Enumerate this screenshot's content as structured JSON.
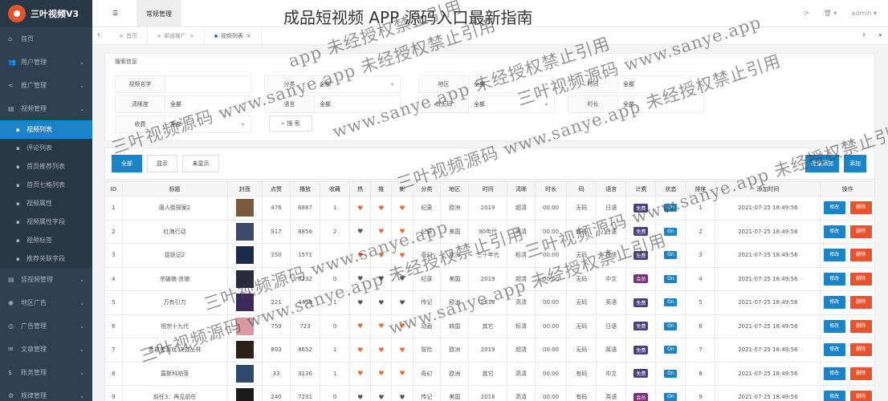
{
  "brand": {
    "title": "三叶视频V3"
  },
  "page_heading": "成品短视频 APP 源码入口最新指南",
  "topbar": {
    "tab_label": "常规管理",
    "user": "admin ▾",
    "refresh_icon": "⟳",
    "trash_icon": "🗑 ▾"
  },
  "tabs": [
    {
      "label": "首页",
      "active": false,
      "closable": false
    },
    {
      "label": "渠道推广",
      "active": false,
      "closable": true
    },
    {
      "label": "视频列表",
      "active": true,
      "closable": true
    }
  ],
  "sidebar": {
    "items_top": [
      {
        "label": "首页",
        "icon": "home-icon",
        "glyph": "⌂",
        "chevron": false
      },
      {
        "label": "用户管理",
        "icon": "users-icon",
        "glyph": "👥",
        "chevron": true
      },
      {
        "label": "推广管理",
        "icon": "share-icon",
        "glyph": "<",
        "chevron": true
      },
      {
        "label": "视频管理",
        "icon": "film-icon",
        "glyph": "▤",
        "chevron": true
      }
    ],
    "sub_items": [
      {
        "label": "视频列表",
        "active": true
      },
      {
        "label": "评论列表",
        "active": false
      },
      {
        "label": "首页推荐列表",
        "active": false
      },
      {
        "label": "首页七格列表",
        "active": false
      },
      {
        "label": "视频属性",
        "active": false
      },
      {
        "label": "视频属性字段",
        "active": false
      },
      {
        "label": "视频标签",
        "active": false
      },
      {
        "label": "推荐关联字段",
        "active": false
      }
    ],
    "items_bottom": [
      {
        "label": "竖视频管理",
        "icon": "film-icon",
        "glyph": "▤",
        "chevron": true
      },
      {
        "label": "地区广告",
        "icon": "globe-icon",
        "glyph": "◉",
        "chevron": true
      },
      {
        "label": "广告管理",
        "icon": "ad-icon",
        "glyph": "◎",
        "chevron": true
      },
      {
        "label": "文章管理",
        "icon": "mail-icon",
        "glyph": "✉",
        "chevron": true
      },
      {
        "label": "账务管理",
        "icon": "dollar-icon",
        "glyph": "$",
        "chevron": true
      },
      {
        "label": "规律管理",
        "icon": "settings-icon",
        "glyph": "⚙",
        "chevron": true
      }
    ]
  },
  "search": {
    "legend": "搜索信息",
    "fields": [
      {
        "label": "视频名字",
        "value": "",
        "dropdown": false
      },
      {
        "label": "分类",
        "value": "全部",
        "dropdown": true
      },
      {
        "label": "地区",
        "value": "全部",
        "dropdown": true
      },
      {
        "label": "时间",
        "value": "全部",
        "dropdown": false
      },
      {
        "label": "清晰度",
        "value": "全部",
        "dropdown": true
      },
      {
        "label": "语言",
        "value": "全部",
        "dropdown": false
      },
      {
        "label": "有无码",
        "value": "全部",
        "dropdown": true
      },
      {
        "label": "时长",
        "value": "全部",
        "dropdown": false
      },
      {
        "label": "收费",
        "value": "全部",
        "dropdown": true
      }
    ],
    "button": "搜 索"
  },
  "toolbar": {
    "filter_all": "全部",
    "filter_show": "显示",
    "filter_hide": "未显示",
    "batch_add": "批量添加",
    "add": "添加"
  },
  "table": {
    "headers": [
      "ID",
      "标题",
      "封面",
      "点赞",
      "播放",
      "收藏",
      "热",
      "推",
      "新",
      "分类",
      "地区",
      "时间",
      "清晰",
      "时长",
      "码",
      "语言",
      "计费",
      "状态",
      "排序",
      "添加时间",
      "操作"
    ],
    "edit_label": "修改",
    "delete_label": "删除",
    "rows": [
      {
        "id": "1",
        "title": "唐人街探案2",
        "cover": "#7a5a3c",
        "likes": "476",
        "plays": "6887",
        "fav": "1",
        "hot": true,
        "rec": true,
        "new": true,
        "cat": "纪录",
        "area": "欧洲",
        "time": "2019",
        "clarity": "超清",
        "dur": "00:00",
        "code": "无码",
        "lang": "日语",
        "fee": "免费",
        "fee_vip": false,
        "status": "On",
        "sort": "1",
        "added": "2021-07-25 18:49:56"
      },
      {
        "id": "2",
        "title": "红海行动",
        "cover": "#3c4a6b",
        "likes": "917",
        "plays": "8856",
        "fav": "2",
        "hot": false,
        "rec": true,
        "new": true,
        "cat": "纪录",
        "area": "美国",
        "time": "90年代",
        "clarity": "高清",
        "dur": "00:00",
        "code": "有码",
        "lang": "日语",
        "fee": "免费",
        "fee_vip": false,
        "status": "On",
        "sort": "2",
        "added": "2021-07-25 18:49:56"
      },
      {
        "id": "3",
        "title": "捉妖记2",
        "cover": "#1e2a4a",
        "likes": "250",
        "plays": "1571",
        "fav": "",
        "hot": true,
        "rec": true,
        "new": true,
        "cat": "奇幻",
        "area": "欧洲",
        "time": "三十年代",
        "clarity": "标清",
        "dur": "00:00",
        "code": "无码",
        "lang": "日语",
        "fee": "免费",
        "fee_vip": false,
        "status": "On",
        "sort": "3",
        "added": "2021-07-25 18:49:56"
      },
      {
        "id": "4",
        "title": "杀破狼·贪狼",
        "cover": "#2a2a3a",
        "likes": "",
        "plays": "8232",
        "fav": "0",
        "hot": false,
        "rec": false,
        "new": false,
        "cat": "纪录",
        "area": "美国",
        "time": "2019",
        "clarity": "超清",
        "dur": "00:00",
        "code": "无码",
        "lang": "中文",
        "fee": "会员",
        "fee_vip": true,
        "status": "On",
        "sort": "4",
        "added": "2021-07-25 18:49:56"
      },
      {
        "id": "5",
        "title": "万有引力",
        "cover": "#3a2a5a",
        "likes": "221",
        "plays": "4499",
        "fav": "1",
        "hot": false,
        "rec": false,
        "new": false,
        "cat": "传记",
        "area": "欧洲",
        "time": "2018",
        "clarity": "高清",
        "dur": "00:00",
        "code": "无码",
        "lang": "英语",
        "fee": "免费",
        "fee_vip": false,
        "status": "On",
        "sort": "5",
        "added": "2021-07-25 18:49:56"
      },
      {
        "id": "6",
        "title": "祖宗十九代",
        "cover": "#d89aa0",
        "likes": "759",
        "plays": "723",
        "fav": "0",
        "hot": true,
        "rec": true,
        "new": true,
        "cat": "动画",
        "area": "韩国",
        "time": "其它",
        "clarity": "标清",
        "dur": "00:00",
        "code": "无码",
        "lang": "日语",
        "fee": "免费",
        "fee_vip": false,
        "status": "On",
        "sort": "6",
        "added": "2021-07-25 18:49:56"
      },
      {
        "id": "7",
        "title": "勇敢者游戏:决战丛林",
        "cover": "#2a2218",
        "likes": "893",
        "plays": "8652",
        "fav": "1",
        "hot": true,
        "rec": true,
        "new": true,
        "cat": "冒险",
        "area": "欧洲",
        "time": "2019",
        "clarity": "超清",
        "dur": "00:00",
        "code": "无码",
        "lang": "英语",
        "fee": "免费",
        "fee_vip": false,
        "status": "On",
        "sort": "7",
        "added": "2021-07-25 18:49:56"
      },
      {
        "id": "8",
        "title": "莫斯科陷落",
        "cover": "#2e4a6a",
        "likes": "33",
        "plays": "3136",
        "fav": "1",
        "hot": true,
        "rec": true,
        "new": true,
        "cat": "奇幻",
        "area": "欧洲",
        "time": "其它",
        "clarity": "高清",
        "dur": "00:00",
        "code": "有码",
        "lang": "中文",
        "fee": "免费",
        "fee_vip": false,
        "status": "On",
        "sort": "8",
        "added": "2021-07-25 18:49:56"
      },
      {
        "id": "9",
        "title": "前任3：再见前任",
        "cover": "#1a1a1a",
        "likes": "240",
        "plays": "7231",
        "fav": "0",
        "hot": false,
        "rec": false,
        "new": false,
        "cat": "传记",
        "area": "美国",
        "time": "2018",
        "clarity": "高清",
        "dur": "00:00",
        "code": "有码",
        "lang": "英语",
        "fee": "会员",
        "fee_vip": true,
        "status": "On",
        "sort": "9",
        "added": "2021-07-25 18:49:56"
      }
    ]
  },
  "watermarks": [
    {
      "text": "app 未经授权禁止引用"
    },
    {
      "text": "三叶视频源码 www.sanye.app 未经授权禁止引用"
    },
    {
      "text": "www.sanye.app 未经授权禁止引用"
    },
    {
      "text": "三叶视频源码 www.sanye.app"
    },
    {
      "text": "三叶视频源码 www.sanye.app 未经授权禁止引用"
    },
    {
      "text": "www.sanye.app 未经授权禁止引用"
    },
    {
      "text": "三叶视频源码 www.sanye.app 未经授权禁止引用"
    },
    {
      "text": "三叶视频源码 www.sanye.app"
    },
    {
      "text": "三叶视频源码 www.sanye.app 未经授权禁止引用"
    }
  ]
}
